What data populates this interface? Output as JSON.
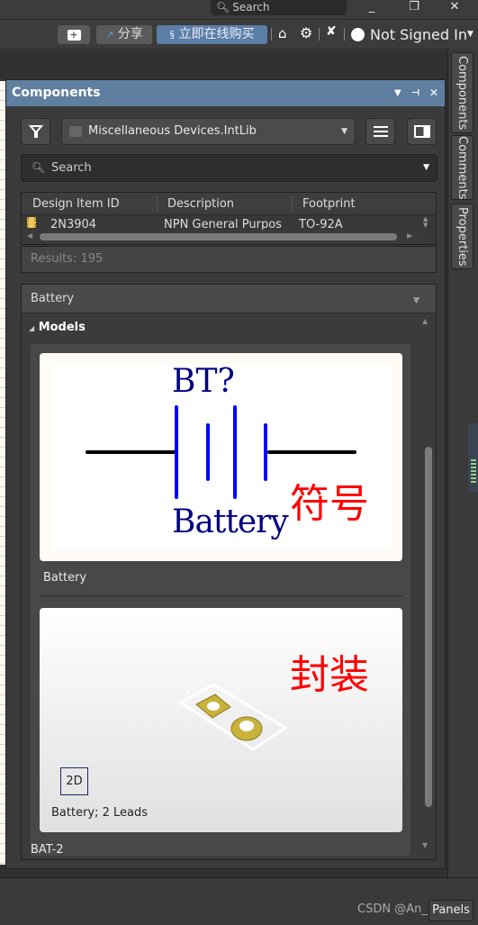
{
  "titlebar": {
    "search_label": "Search",
    "minimize": "_",
    "maximize": "❐",
    "close": "✕"
  },
  "toolbar": {
    "share_label": "分享",
    "buy_label": "立即在线购买",
    "user_label": "Not Signed In"
  },
  "panel": {
    "title": "Components",
    "library": "Miscellaneous Devices.IntLib",
    "search_placeholder": "Search",
    "columns": [
      "Design Item ID",
      "Description",
      "Footprint"
    ],
    "rows": [
      {
        "id": "2N3904",
        "description": "NPN General Purpos",
        "footprint": "TO-92A"
      }
    ],
    "results": "Results: 195",
    "details_title": "Battery",
    "models_title": "Models",
    "symbol_model": {
      "designator": "BT?",
      "comment": "Battery",
      "annotation": "符号",
      "label": "Battery"
    },
    "footprint_model": {
      "annotation": "封装",
      "view_toggle": "2D",
      "description": "Battery; 2 Leads",
      "label": "BAT-2"
    }
  },
  "side_tabs": [
    "Components",
    "Comments",
    "Properties"
  ],
  "statusbar": {
    "watermark": "CSDN @An_m...",
    "panels_button": "Panels"
  },
  "colors": {
    "panel_header": "#5f7fa0",
    "buy_button": "#5b7fa6",
    "symbol_blue": "#0000ff",
    "symbol_text": "#000080",
    "annotation_red": "#ff0000",
    "pad_gold": "#c9b23a"
  }
}
